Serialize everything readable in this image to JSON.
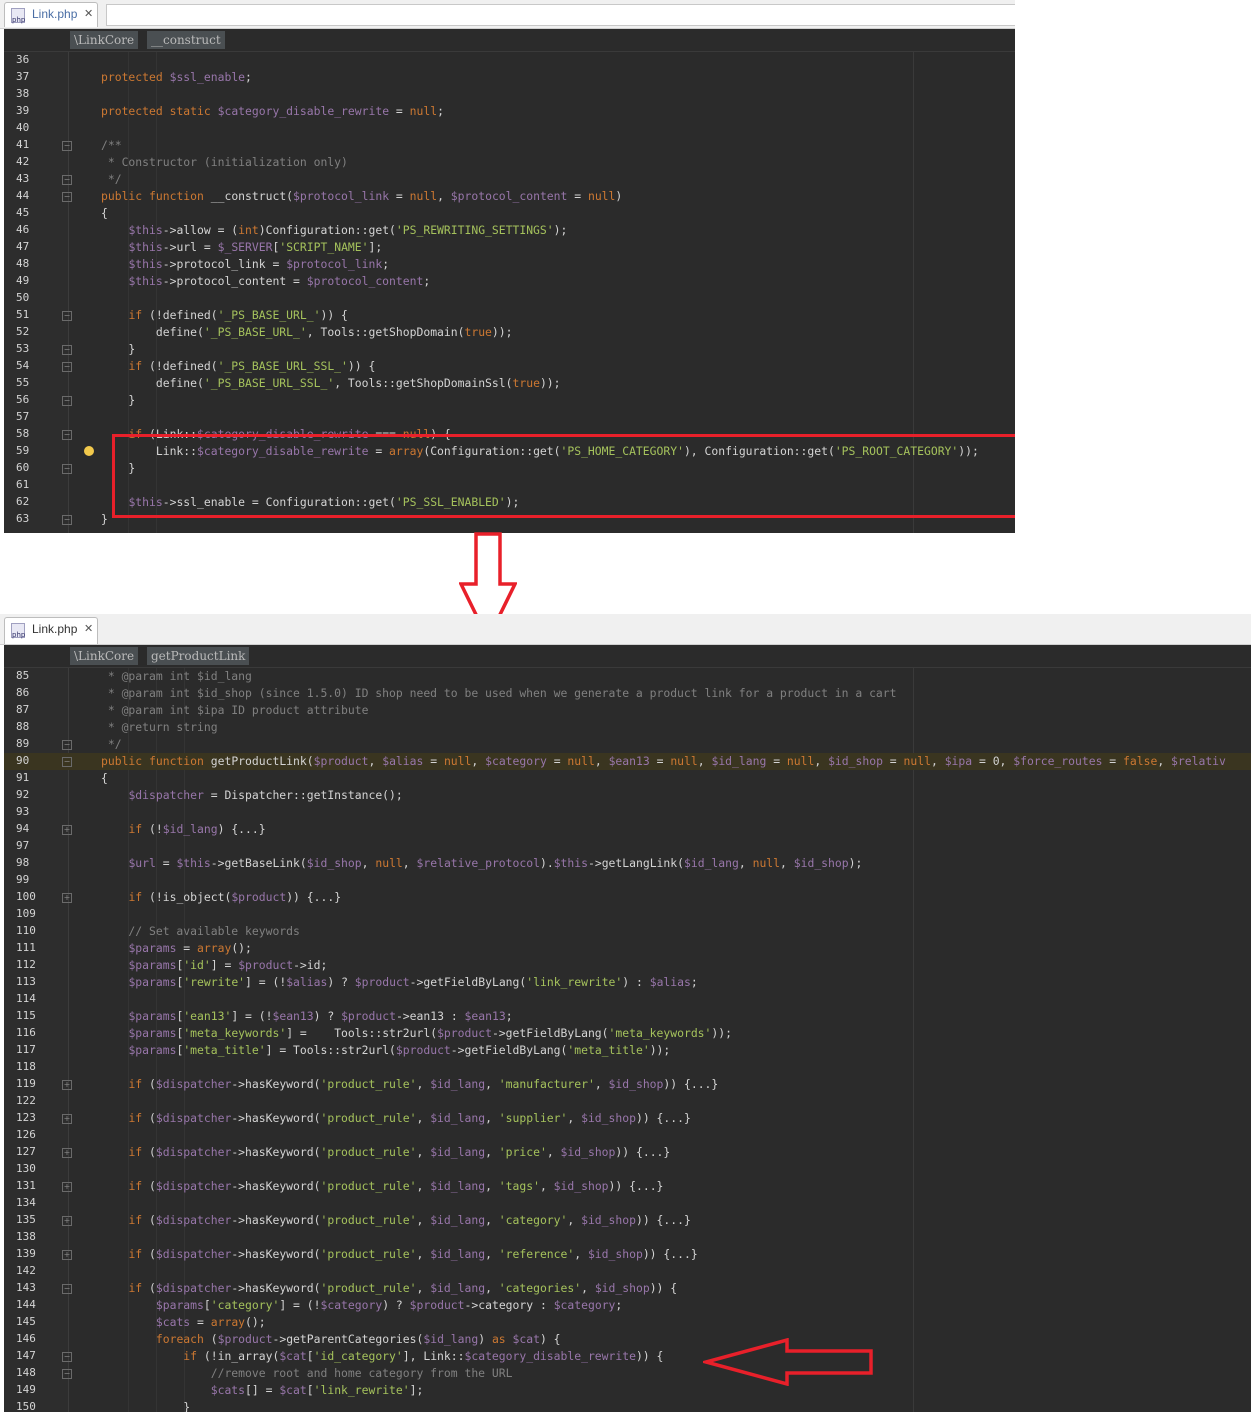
{
  "top_panel": {
    "tab": {
      "icon": "php-file-icon",
      "icon_text": "php",
      "label": "Link.php",
      "close": "✕"
    },
    "breadcrumbs": [
      "\\LinkCore",
      "__construct"
    ],
    "lines": [
      {
        "n": "36",
        "text": ""
      },
      {
        "n": "37",
        "text": "protected $ssl_enable;"
      },
      {
        "n": "38",
        "text": ""
      },
      {
        "n": "39",
        "text": "protected static $category_disable_rewrite = null;"
      },
      {
        "n": "40",
        "text": ""
      },
      {
        "n": "41",
        "text": "/**"
      },
      {
        "n": "42",
        "text": " * Constructor (initialization only)"
      },
      {
        "n": "43",
        "text": " */"
      },
      {
        "n": "44",
        "text": "public function __construct($protocol_link = null, $protocol_content = null)"
      },
      {
        "n": "45",
        "text": "{"
      },
      {
        "n": "46",
        "text": "    $this->allow = (int)Configuration::get('PS_REWRITING_SETTINGS');"
      },
      {
        "n": "47",
        "text": "    $this->url = $_SERVER['SCRIPT_NAME'];"
      },
      {
        "n": "48",
        "text": "    $this->protocol_link = $protocol_link;"
      },
      {
        "n": "49",
        "text": "    $this->protocol_content = $protocol_content;"
      },
      {
        "n": "50",
        "text": ""
      },
      {
        "n": "51",
        "text": "    if (!defined('_PS_BASE_URL_')) {"
      },
      {
        "n": "52",
        "text": "        define('_PS_BASE_URL_', Tools::getShopDomain(true));"
      },
      {
        "n": "53",
        "text": "    }"
      },
      {
        "n": "54",
        "text": "    if (!defined('_PS_BASE_URL_SSL_')) {"
      },
      {
        "n": "55",
        "text": "        define('_PS_BASE_URL_SSL_', Tools::getShopDomainSsl(true));"
      },
      {
        "n": "56",
        "text": "    }"
      },
      {
        "n": "57",
        "text": ""
      },
      {
        "n": "58",
        "text": "    if (Link::$category_disable_rewrite === null) {"
      },
      {
        "n": "59",
        "text": "        Link::$category_disable_rewrite = array(Configuration::get('PS_HOME_CATEGORY'), Configuration::get('PS_ROOT_CATEGORY'));"
      },
      {
        "n": "60",
        "text": "    }"
      },
      {
        "n": "61",
        "text": ""
      },
      {
        "n": "62",
        "text": "    $this->ssl_enable = Configuration::get('PS_SSL_ENABLED');"
      },
      {
        "n": "63",
        "text": "}"
      }
    ]
  },
  "bottom_panel": {
    "tab": {
      "icon": "php-file-icon",
      "icon_text": "php",
      "label": "Link.php",
      "close": "✕"
    },
    "breadcrumbs": [
      "\\LinkCore",
      "getProductLink"
    ],
    "lines": [
      {
        "n": "85",
        "text": " * @param int $id_lang"
      },
      {
        "n": "86",
        "text": " * @param int $id_shop (since 1.5.0) ID shop need to be used when we generate a product link for a product in a cart"
      },
      {
        "n": "87",
        "text": " * @param int $ipa ID product attribute"
      },
      {
        "n": "88",
        "text": " * @return string"
      },
      {
        "n": "89",
        "text": " */"
      },
      {
        "n": "90",
        "text": "public function getProductLink($product, $alias = null, $category = null, $ean13 = null, $id_lang = null, $id_shop = null, $ipa = 0, $force_routes = false, $relativ"
      },
      {
        "n": "91",
        "text": "{"
      },
      {
        "n": "92",
        "text": "    $dispatcher = Dispatcher::getInstance();"
      },
      {
        "n": "93",
        "text": ""
      },
      {
        "n": "94",
        "text": "    if (!$id_lang) {...}"
      },
      {
        "n": "97",
        "text": ""
      },
      {
        "n": "98",
        "text": "    $url = $this->getBaseLink($id_shop, null, $relative_protocol).$this->getLangLink($id_lang, null, $id_shop);"
      },
      {
        "n": "99",
        "text": ""
      },
      {
        "n": "100",
        "text": "    if (!is_object($product)) {...}"
      },
      {
        "n": "109",
        "text": ""
      },
      {
        "n": "110",
        "text": "    // Set available keywords"
      },
      {
        "n": "111",
        "text": "    $params = array();"
      },
      {
        "n": "112",
        "text": "    $params['id'] = $product->id;"
      },
      {
        "n": "113",
        "text": "    $params['rewrite'] = (!$alias) ? $product->getFieldByLang('link_rewrite') : $alias;"
      },
      {
        "n": "114",
        "text": ""
      },
      {
        "n": "115",
        "text": "    $params['ean13'] = (!$ean13) ? $product->ean13 : $ean13;"
      },
      {
        "n": "116",
        "text": "    $params['meta_keywords'] =    Tools::str2url($product->getFieldByLang('meta_keywords'));"
      },
      {
        "n": "117",
        "text": "    $params['meta_title'] = Tools::str2url($product->getFieldByLang('meta_title'));"
      },
      {
        "n": "118",
        "text": ""
      },
      {
        "n": "119",
        "text": "    if ($dispatcher->hasKeyword('product_rule', $id_lang, 'manufacturer', $id_shop)) {...}"
      },
      {
        "n": "122",
        "text": ""
      },
      {
        "n": "123",
        "text": "    if ($dispatcher->hasKeyword('product_rule', $id_lang, 'supplier', $id_shop)) {...}"
      },
      {
        "n": "126",
        "text": ""
      },
      {
        "n": "127",
        "text": "    if ($dispatcher->hasKeyword('product_rule', $id_lang, 'price', $id_shop)) {...}"
      },
      {
        "n": "130",
        "text": ""
      },
      {
        "n": "131",
        "text": "    if ($dispatcher->hasKeyword('product_rule', $id_lang, 'tags', $id_shop)) {...}"
      },
      {
        "n": "134",
        "text": ""
      },
      {
        "n": "135",
        "text": "    if ($dispatcher->hasKeyword('product_rule', $id_lang, 'category', $id_shop)) {...}"
      },
      {
        "n": "138",
        "text": ""
      },
      {
        "n": "139",
        "text": "    if ($dispatcher->hasKeyword('product_rule', $id_lang, 'reference', $id_shop)) {...}"
      },
      {
        "n": "142",
        "text": ""
      },
      {
        "n": "143",
        "text": "    if ($dispatcher->hasKeyword('product_rule', $id_lang, 'categories', $id_shop)) {"
      },
      {
        "n": "144",
        "text": "        $params['category'] = (!$category) ? $product->category : $category;"
      },
      {
        "n": "145",
        "text": "        $cats = array();"
      },
      {
        "n": "146",
        "text": "        foreach ($product->getParentCategories($id_lang) as $cat) {"
      },
      {
        "n": "147",
        "text": "            if (!in_array($cat['id_category'], Link::$category_disable_rewrite)) {"
      },
      {
        "n": "148",
        "text": "                //remove root and home category from the URL"
      },
      {
        "n": "149",
        "text": "                $cats[] = $cat['link_rewrite'];"
      },
      {
        "n": "150",
        "text": "            }"
      }
    ]
  },
  "colors": {
    "editor_bg": "#2b2b2b",
    "keyword": "#cc7832",
    "variable": "#9876aa",
    "string": "#a5c25c",
    "comment": "#808080",
    "annotation": "#e8202a"
  }
}
